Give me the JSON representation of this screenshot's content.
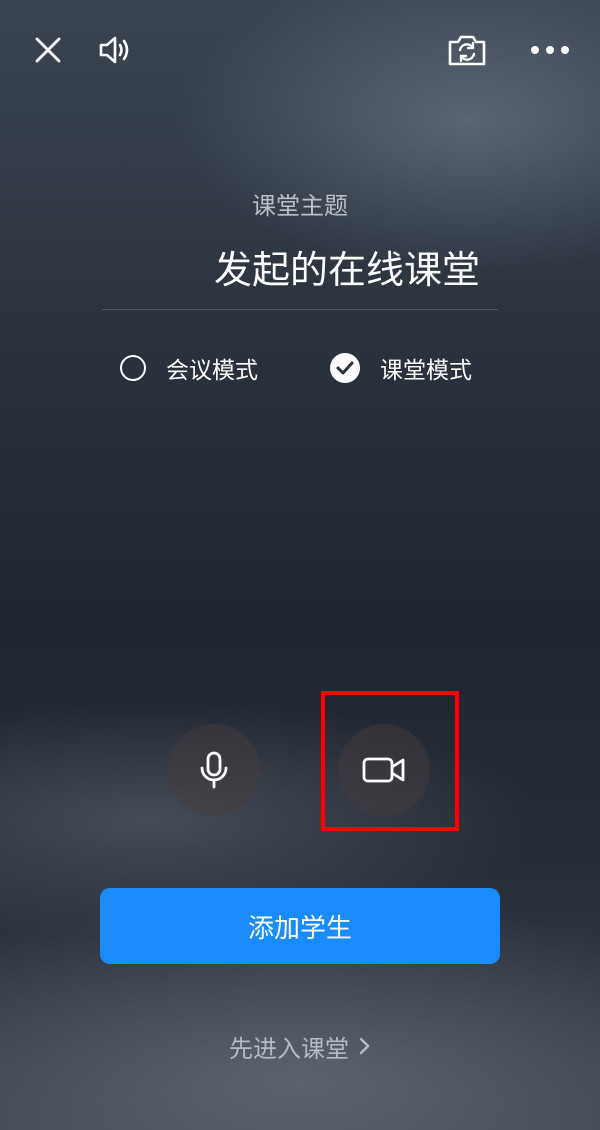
{
  "header": {
    "close_icon": "close-icon",
    "speaker_icon": "speaker-icon",
    "camera_switch_icon": "camera-switch-icon",
    "more_icon": "more-icon"
  },
  "topic": {
    "label": "课堂主题",
    "title": "发起的在线课堂"
  },
  "modes": {
    "meeting_label": "会议模式",
    "class_label": "课堂模式",
    "selected": "class"
  },
  "controls": {
    "mic_icon": "microphone-icon",
    "video_icon": "video-camera-icon"
  },
  "actions": {
    "add_student": "添加学生",
    "enter_class": "先进入课堂"
  },
  "colors": {
    "primary_button": "#1a8cff",
    "highlight": "#ff0000"
  }
}
